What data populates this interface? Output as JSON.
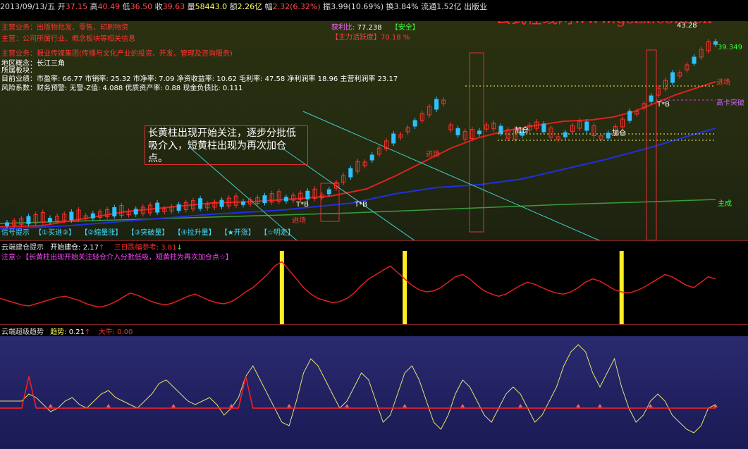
{
  "watermark": "公式在线网www.gszx.com.cn",
  "header": {
    "date": "2013/09/13/五",
    "open_label": "开",
    "open": "37.15",
    "high_label": "高",
    "high": "40.49",
    "low_label": "低",
    "low": "36.50",
    "close_label": "收",
    "close": "39.63",
    "volume_label": "量",
    "volume": "58443.0",
    "amount_label": "额",
    "amount": "2.26亿",
    "change_label": "幅",
    "change": "2.32(6.32%)",
    "amplitude_label": "振",
    "amplitude": "3.99(10.69%)",
    "turnover_label": "换",
    "turnover": "3.84%",
    "float_label": "流通",
    "float": "1.52亿",
    "sector": "出版业"
  },
  "info_lines": [
    "主营业务：出版物批发、零售、印刷物资",
    "主营：公司所属行业、概念板块等相关信息",
    "主营业务：报业传媒集团(传播与文化产业的投资、开发、管理及咨询服务)",
    "地区概念：长江三角",
    "所属板块：",
    "目前业绩：市盈率: 66.77 市销率: 25.32 市净率: 7.09 净资收益率: 10.62 毛利率: 47.58 净利润率 18.96 主营利润率 23.17",
    "风险系数：财务预警: 无警-Z值: 4.088 优质资产率: 0.88 现金负债比: 0.111"
  ],
  "right_info": {
    "profit_label": "获利比:",
    "profit_value": "77.238",
    "safety": "【安全】",
    "activity": "【主力活跃度】70.18 %"
  },
  "annotation": "长黄柱出现开始关注，逐步分批低吸介入，短黄柱出现为再次加仓点。",
  "price_labels": {
    "peak": "43.28",
    "last": "39.349",
    "enter1": "进场",
    "enter2": "进场",
    "enter3": "进场",
    "add1": "加仓",
    "add2": "加仓",
    "tb1": "T*B",
    "tb2": "T*B",
    "tb3": "T*B",
    "main": "主成",
    "top": "高卡突破"
  },
  "signal_bar": [
    "信号提示",
    "【①买进③】",
    "【②缩量涨】",
    "【③突破量】",
    "【④拉升量】",
    "【★开涨】",
    "【☆明走】"
  ],
  "panel2": {
    "title": "云端建仓提示",
    "open_label": "开始建仓:",
    "open_value": "2.17",
    "three_day_label": "三日跌幅参考:",
    "three_day_value": "3.81",
    "notice": "注意☆【长黄柱出现开始关注轻仓介入分批低吸，短黄柱为再次加仓点☆】"
  },
  "panel3": {
    "title": "云端超级趋势",
    "trend_label": "趋势:",
    "trend_value": "0.21",
    "big_label": "大牛:",
    "big_value": "0.00"
  },
  "chart_data": [
    {
      "type": "line",
      "title": "云端建仓提示",
      "x": [
        1,
        2,
        3,
        4,
        5,
        6,
        7,
        8,
        9,
        10,
        11,
        12,
        13,
        14,
        15,
        16,
        17,
        18,
        19,
        20,
        21,
        22,
        23,
        24,
        25,
        26,
        27,
        28,
        29,
        30,
        31,
        32,
        33,
        34,
        35,
        36,
        37,
        38,
        39,
        40,
        41,
        42,
        43,
        44,
        45,
        46,
        47,
        48,
        49,
        50,
        51,
        52,
        53,
        54,
        55,
        56,
        57,
        58,
        59,
        60,
        61,
        62,
        63,
        64,
        65,
        66,
        67,
        68,
        69,
        70,
        71,
        72,
        73,
        74,
        75,
        76,
        77,
        78,
        79,
        80,
        81,
        82,
        83,
        84,
        85,
        86,
        87,
        88,
        89,
        90,
        91,
        92,
        93,
        94,
        95,
        96,
        97,
        98,
        99,
        100
      ],
      "series": [
        {
          "values": [
            40,
            38,
            36,
            34,
            33,
            35,
            37,
            39,
            41,
            42,
            40,
            38,
            35,
            33,
            32,
            34,
            37,
            41,
            45,
            43,
            40,
            37,
            35,
            34,
            36,
            39,
            42,
            44,
            41,
            38,
            36,
            35,
            37,
            41,
            46,
            50,
            56,
            62,
            70,
            74,
            66,
            58,
            50,
            44,
            40,
            38,
            36,
            37,
            40,
            45,
            52,
            58,
            62,
            66,
            70,
            64,
            58,
            52,
            48,
            46,
            47,
            50,
            55,
            60,
            62,
            58,
            52,
            47,
            44,
            42,
            44,
            48,
            52,
            55,
            53,
            50,
            47,
            45,
            44,
            46,
            50,
            55,
            58,
            56,
            52,
            48,
            46,
            45,
            47,
            50,
            54,
            58,
            62,
            60,
            56,
            52,
            50,
            55,
            60,
            58
          ]
        }
      ],
      "highlight_bars": [
        {
          "x": 40,
          "height": "long"
        },
        {
          "x": 57,
          "height": "long"
        },
        {
          "x": 87,
          "height": "long"
        }
      ]
    },
    {
      "type": "line",
      "title": "云端超级趋势",
      "x": [
        1,
        2,
        3,
        4,
        5,
        6,
        7,
        8,
        9,
        10,
        11,
        12,
        13,
        14,
        15,
        16,
        17,
        18,
        19,
        20,
        21,
        22,
        23,
        24,
        25,
        26,
        27,
        28,
        29,
        30,
        31,
        32,
        33,
        34,
        35,
        36,
        37,
        38,
        39,
        40,
        41,
        42,
        43,
        44,
        45,
        46,
        47,
        48,
        49,
        50,
        51,
        52,
        53,
        54,
        55,
        56,
        57,
        58,
        59,
        60,
        61,
        62,
        63,
        64,
        65,
        66,
        67,
        68,
        69,
        70,
        71,
        72,
        73,
        74,
        75,
        76,
        77,
        78,
        79,
        80,
        81,
        82,
        83,
        84,
        85,
        86,
        87,
        88,
        89,
        90,
        91,
        92,
        93,
        94,
        95,
        96,
        97,
        98,
        99,
        100
      ],
      "series": [
        {
          "values": [
            0.1,
            0.1,
            0.1,
            0.1,
            0.2,
            0.15,
            0.05,
            -0.05,
            0.0,
            0.1,
            0.15,
            0.05,
            0.0,
            0.1,
            0.2,
            0.25,
            0.15,
            0.1,
            0.05,
            0.0,
            0.1,
            0.2,
            0.35,
            0.4,
            0.3,
            0.2,
            0.1,
            0.05,
            0.1,
            0.15,
            0.05,
            -0.1,
            0.0,
            0.15,
            0.45,
            0.6,
            0.4,
            0.2,
            0.0,
            -0.2,
            -0.25,
            0.1,
            0.5,
            0.7,
            0.6,
            0.4,
            0.2,
            0.0,
            0.1,
            0.3,
            0.5,
            0.4,
            0.1,
            -0.2,
            -0.1,
            0.2,
            0.5,
            0.6,
            0.4,
            0.1,
            -0.2,
            -0.3,
            -0.1,
            0.2,
            0.4,
            0.3,
            0.1,
            -0.1,
            -0.2,
            0.0,
            0.2,
            0.3,
            0.2,
            0.0,
            -0.2,
            -0.1,
            0.1,
            0.3,
            0.6,
            0.8,
            0.9,
            0.8,
            0.5,
            0.3,
            0.5,
            0.7,
            0.3,
            0.0,
            -0.2,
            -0.1,
            0.1,
            0.2,
            0.1,
            -0.1,
            -0.2,
            -0.3,
            -0.35,
            -0.25,
            0.0,
            0.05
          ]
        },
        {
          "values": [
            0.0,
            0.0,
            0.0,
            0.0,
            0.45,
            0.0,
            0.0,
            0.0,
            0.0,
            0.0,
            0.0,
            0.0,
            0.0,
            0.0,
            0.0,
            0.0,
            0.0,
            0.0,
            0.0,
            0.0,
            0.0,
            0.0,
            0.0,
            0.0,
            0.0,
            0.0,
            0.0,
            0.0,
            0.0,
            0.0,
            0.0,
            0.0,
            0.0,
            0.0,
            0.45,
            0.0,
            0.0,
            0.0,
            0.0,
            0.0,
            0.0,
            0.0,
            0.0,
            0.0,
            0.0,
            0.0,
            0.0,
            0.0,
            0.0,
            0.0,
            0.0,
            0.0,
            0.0,
            0.0,
            0.0,
            0.0,
            0.0,
            0.0,
            0.0,
            0.0,
            0.0,
            0.0,
            0.0,
            0.0,
            0.0,
            0.0,
            0.0,
            0.0,
            0.0,
            0.0,
            0.0,
            0.0,
            0.0,
            0.0,
            0.0,
            0.0,
            0.0,
            0.0,
            0.0,
            0.0,
            0.0,
            0.0,
            0.0,
            0.0,
            0.0,
            0.0,
            0.0,
            0.0,
            0.0,
            0.0,
            0.0,
            0.0,
            0.0,
            0.0,
            0.0,
            0.0,
            0.0,
            0.0,
            0.0,
            0.0
          ]
        }
      ]
    }
  ]
}
